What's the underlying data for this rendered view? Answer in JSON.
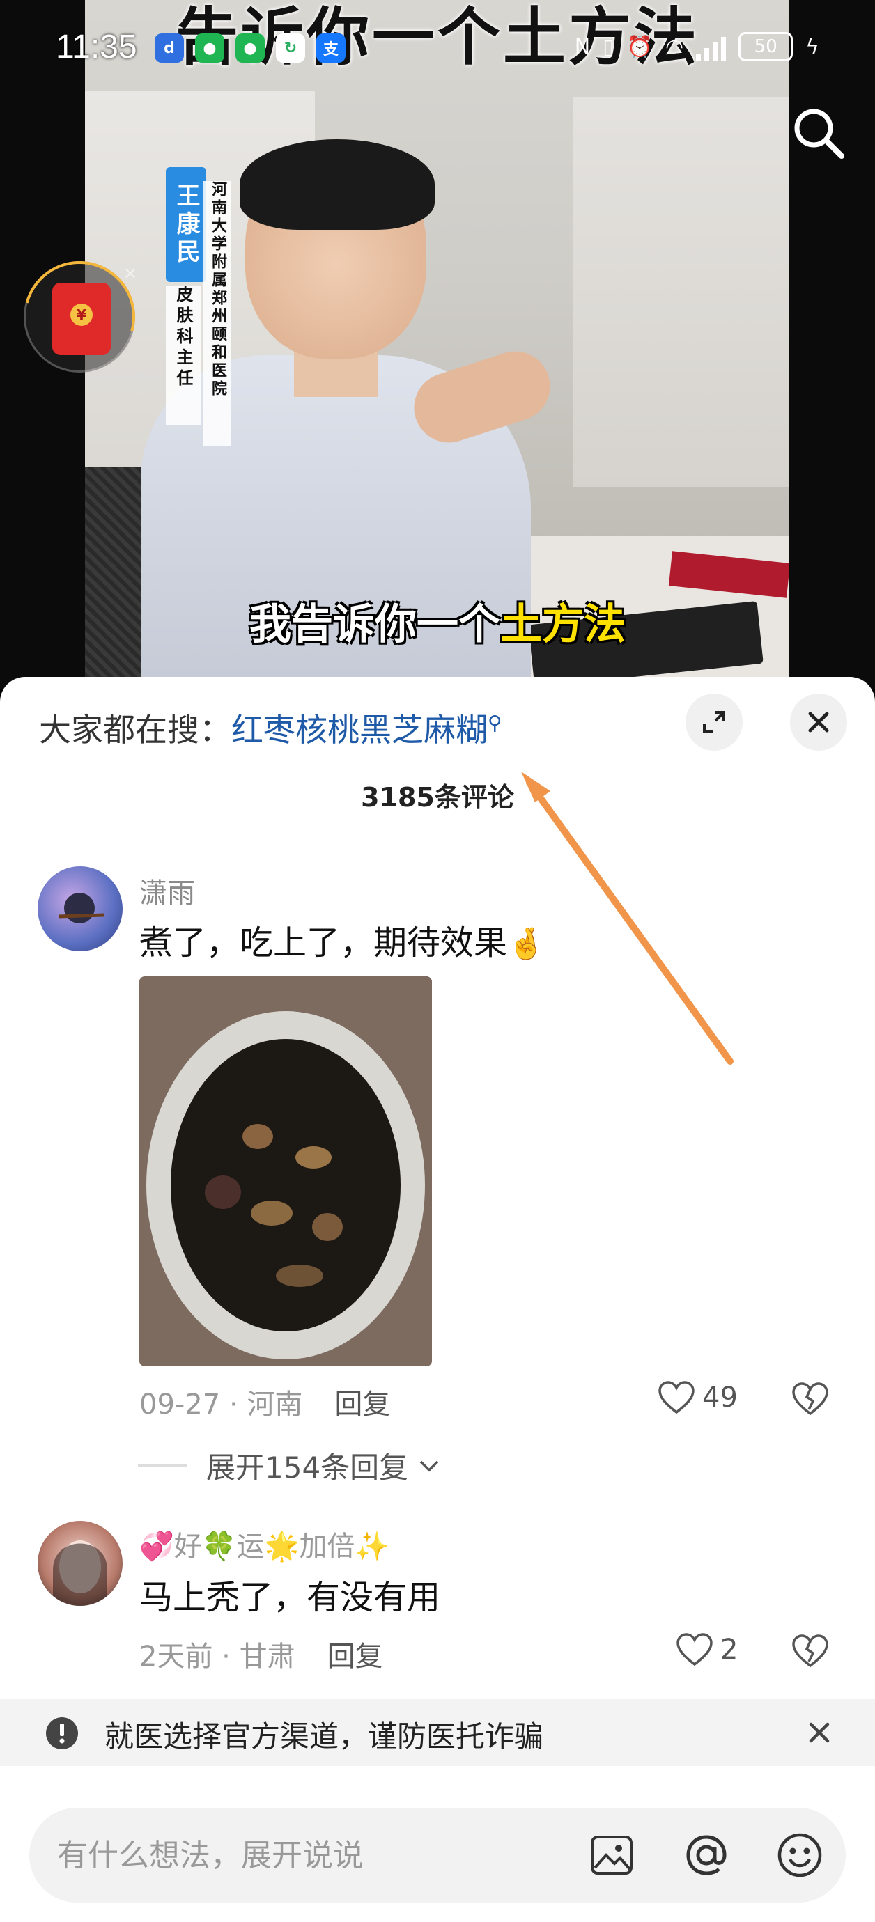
{
  "status_bar": {
    "time": "11:35",
    "battery": "50",
    "app_icons": [
      "notification-app-icon",
      "wechat-icon",
      "wechat-icon",
      "sync-icon",
      "alipay-icon"
    ]
  },
  "video": {
    "top_title": "告诉你一个土方法",
    "doctor_name": "王康民",
    "doctor_title": "皮肤科主任",
    "hospital": "河南大学附属郑州颐和医院",
    "subtitle_prefix": "我告诉你一个",
    "subtitle_highlight": "土方法"
  },
  "sheet": {
    "search_label": "大家都在搜：",
    "search_term": "红枣核桃黑芝麻糊",
    "comment_count": "3185条评论"
  },
  "comments": [
    {
      "username": "潇雨",
      "text": "煮了，吃上了，期待效果",
      "date_location": "09-27 · 河南",
      "reply_label": "回复",
      "likes": "49",
      "expand_label": "展开154条回复"
    },
    {
      "username": "💞好🍀运🌟加倍✨",
      "text": "马上秃了，有没有用",
      "date_location": "2天前 · 甘肃",
      "reply_label": "回复",
      "likes": "2"
    }
  ],
  "notice": {
    "text": "就医选择官方渠道，谨防医托诈骗"
  },
  "input": {
    "placeholder": "有什么想法，展开说说"
  },
  "colors": {
    "accent_link": "#1e5aa8",
    "arrow": "#f0954a",
    "highlight": "#ffe100"
  }
}
